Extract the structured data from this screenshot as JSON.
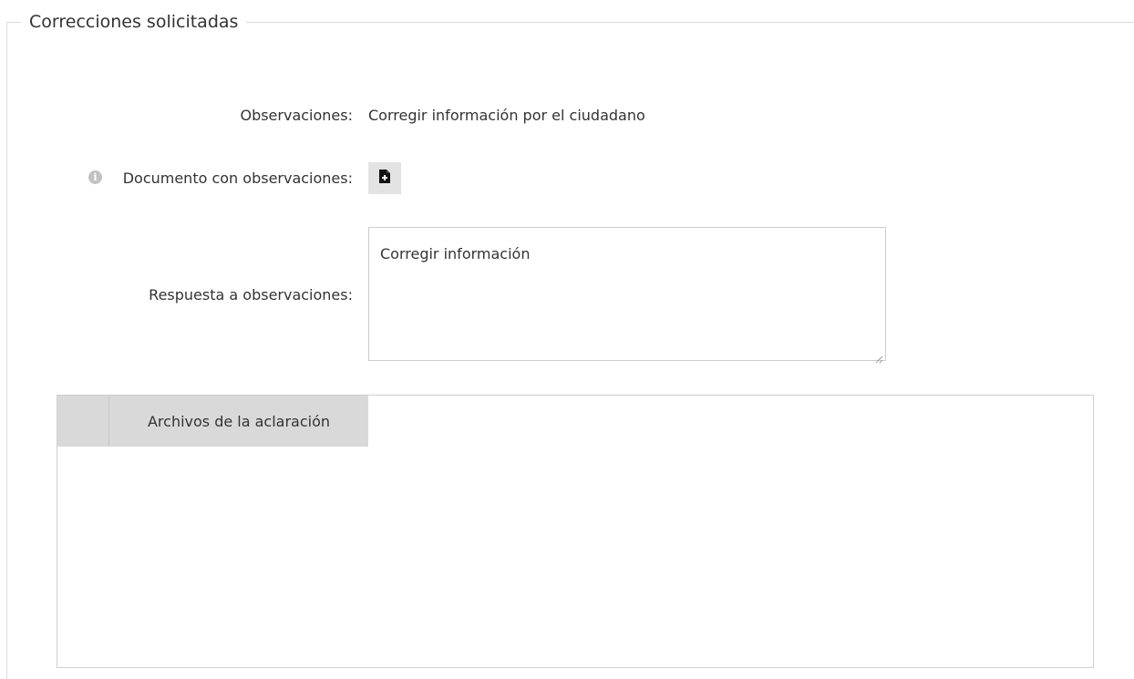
{
  "section": {
    "title": "Correcciones solicitadas"
  },
  "observaciones": {
    "label": "Observaciones:",
    "value": "Corregir información por el ciudadano"
  },
  "documento": {
    "info_icon": "info-icon",
    "label": "Documento con observaciones:",
    "button_icon": "file-download-icon"
  },
  "respuesta": {
    "label": "Respuesta a observaciones:",
    "value": "Corregir información"
  },
  "archivos": {
    "header": "Archivos de la aclaración"
  },
  "colors": {
    "border": "#dcdcdc",
    "header_bg": "#d9d9d9",
    "button_bg": "#e3e3e3",
    "icon_dark": "#111111"
  }
}
